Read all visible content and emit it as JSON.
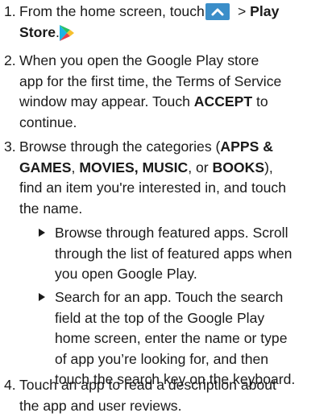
{
  "steps": [
    {
      "number": "1.",
      "line1_pre": "From the home screen, touch",
      "line1_sep": ">",
      "line1_bold": "Play",
      "line2_bold": "Store",
      "line2_post": "."
    },
    {
      "number": "2.",
      "lines": [
        "When you open the Google Play store",
        "app for the first time, the Terms of Service",
        "window may appear. Touch ",
        "continue."
      ],
      "accept": "ACCEPT",
      "accept_post": " to"
    },
    {
      "number": "3.",
      "l1_pre": "Browse through the categories (",
      "l1_bold": "APPS &",
      "l2_bold1": "GAMES",
      "l2_sep": ", ",
      "l2_bold2": "MOVIES, MUSIC",
      "l2_mid": ", or ",
      "l2_bold3": "BOOKS",
      "l2_post": "),",
      "l3": "find an item you're interested in, and touch",
      "l4": "the name."
    },
    {
      "number": "4.",
      "lines": [
        "Touch an app to read a description about",
        "the app and user reviews."
      ]
    }
  ],
  "bullets": [
    {
      "lines": [
        "Browse through featured apps. Scroll",
        "through the list of featured apps when",
        "you open Google Play."
      ]
    },
    {
      "lines": [
        "Search for an app. Touch the search",
        "field at the top of the Google Play",
        "home screen, enter the name or type",
        "of app you’re looking for, and then",
        "touch the search key on the keyboard."
      ]
    }
  ],
  "icons": {
    "home_up": "chevron-up-icon",
    "play_store": "play-store-icon",
    "bullet": "triangle-bullet-icon"
  },
  "colors": {
    "home_icon_bg": "#3b8ec9"
  }
}
